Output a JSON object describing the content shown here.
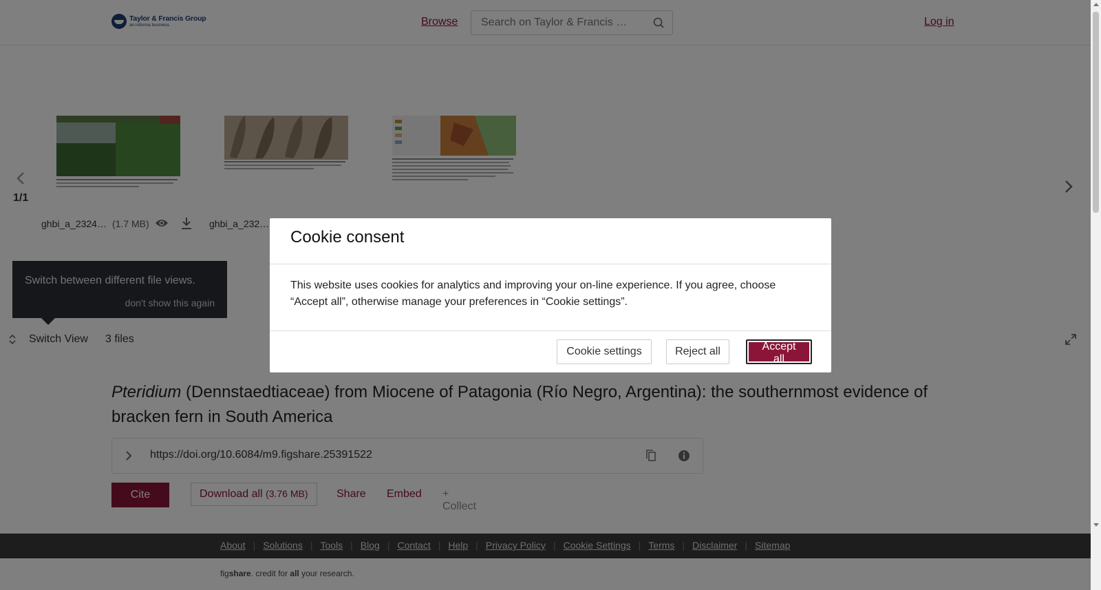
{
  "header": {
    "logo_line1": "Taylor & Francis Group",
    "logo_line2": "an informa business",
    "browse": "Browse",
    "search_placeholder": "Search on Taylor & Francis Online",
    "login": "Log in"
  },
  "gallery": {
    "pager": "1/1",
    "files": [
      {
        "name": "ghbi_a_2324…",
        "size": "(1.7 MB)"
      },
      {
        "name": "ghbi_a_232…"
      },
      {
        "name": ""
      }
    ]
  },
  "tooltip": {
    "text": "Switch between different file views.",
    "dismiss": "don't show this again"
  },
  "viewbar": {
    "switch_view": "Switch View",
    "files_count": "3 files"
  },
  "article": {
    "title_italic": "Pteridium",
    "title_rest": " (Dennstaedtiaceae) from Miocene of Patagonia (Río Negro, Argentina): the southernmost evidence of bracken fern in South America",
    "doi": "https://doi.org/10.6084/m9.figshare.25391522",
    "cite": "Cite",
    "download_all": "Download all",
    "download_size": "(3.76 MB)",
    "share": "Share",
    "embed": "Embed",
    "collect": "+ Collect"
  },
  "footer": {
    "links": [
      "About",
      "Solutions",
      "Tools",
      "Blog",
      "Contact",
      "Help",
      "Privacy Policy",
      "Cookie Settings",
      "Terms",
      "Disclaimer",
      "Sitemap"
    ],
    "credit_fig": "fig",
    "credit_share": "share",
    "credit_mid": ". credit for ",
    "credit_all": "all",
    "credit_end": " your research."
  },
  "cookie": {
    "title": "Cookie consent",
    "body": "This website uses cookies for analytics and improving your on-line experience. If you agree, choose “Accept all”, otherwise manage your preferences in “Cookie settings”.",
    "settings": "Cookie settings",
    "reject": "Reject all",
    "accept": "Accept all"
  },
  "colors": {
    "brand": "#8a1538",
    "overlay": "rgba(0,0,0,0.5)",
    "footer_bg": "#3a3a3a"
  }
}
